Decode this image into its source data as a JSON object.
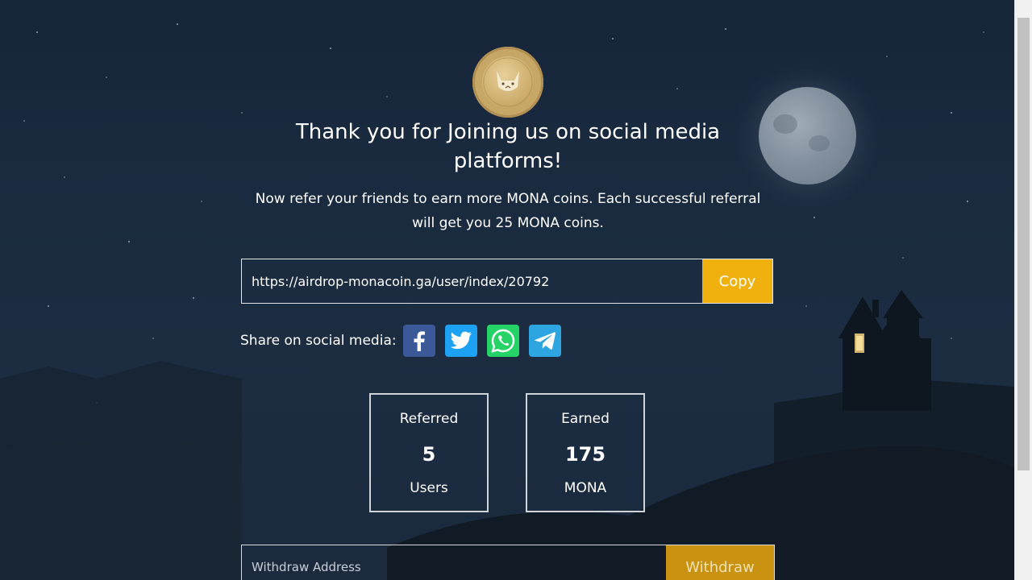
{
  "header": {
    "title": "Thank you for Joining us on social media platforms!",
    "subtitle": "Now refer your friends to earn more MONA coins. Each successful referral will get you 25 MONA coins."
  },
  "referral": {
    "link": "https://airdrop-monacoin.ga/user/index/20792",
    "copy_label": "Copy"
  },
  "share": {
    "label": "Share on social media:",
    "networks": [
      {
        "name": "Facebook",
        "icon": "facebook-icon",
        "color": "#3b5998"
      },
      {
        "name": "Twitter",
        "icon": "twitter-icon",
        "color": "#1da1f2"
      },
      {
        "name": "WhatsApp",
        "icon": "whatsapp-icon",
        "color": "#25d366"
      },
      {
        "name": "Telegram",
        "icon": "telegram-icon",
        "color": "#2ca5e0"
      }
    ]
  },
  "stats": {
    "referred": {
      "label": "Referred",
      "value": "5",
      "unit": "Users"
    },
    "earned": {
      "label": "Earned",
      "value": "175",
      "unit": "MONA"
    }
  },
  "withdraw": {
    "placeholder": "Withdraw Address",
    "button_label": "Withdraw"
  },
  "theme": {
    "accent": "#f0b10f",
    "background": "#1a2b40"
  }
}
